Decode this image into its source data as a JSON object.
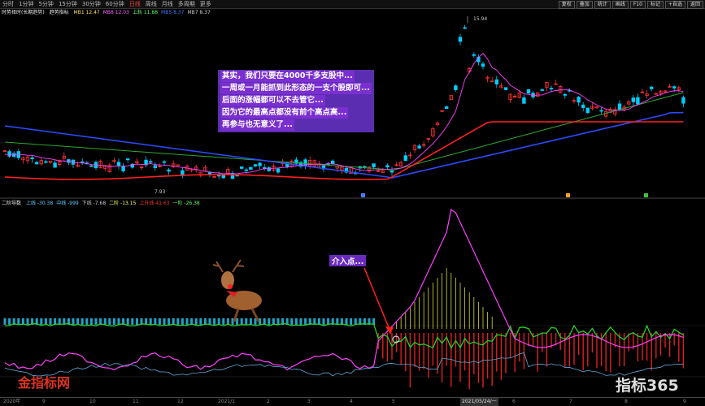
{
  "toolbar": {
    "tabs": [
      "分时",
      "1分钟",
      "5分钟",
      "15分钟",
      "30分钟",
      "60分钟",
      "日线",
      "周线",
      "月线",
      "多周期",
      "更多"
    ],
    "active_index": 6,
    "right_buttons": [
      "复权",
      "叠加",
      "统计",
      "画线",
      "F10",
      "标记",
      "+自选",
      "返回"
    ]
  },
  "indicators": {
    "title": "时势择时(长期趋势)",
    "sub": "趋势指标",
    "items": [
      {
        "text": "MB1 12.47",
        "color": "#ffe066"
      },
      {
        "text": "MB8 12.03",
        "color": "#ff66ff"
      },
      {
        "text": "上轨 11.88",
        "color": "#66ff66"
      },
      {
        "text": "MB5 8.37",
        "color": "#4a7aff"
      },
      {
        "text": "MB7 8.37",
        "color": "#cccccc"
      }
    ]
  },
  "sub_indicators": {
    "title": "二阶导数",
    "items": [
      {
        "text": "上线 -30.38",
        "color": "#66ccff"
      },
      {
        "text": "中线 -999",
        "color": "#66ccff"
      },
      {
        "text": "下线 -7.68",
        "color": "#cccccc"
      },
      {
        "text": "二阶 -13.15",
        "color": "#ffff66"
      },
      {
        "text": "上升线 41.63",
        "color": "#ff3333"
      },
      {
        "text": "一阶 -26.38",
        "color": "#66ff66"
      }
    ]
  },
  "annotations": {
    "note_lines": [
      "其实，我们只要在4000千多支股中...",
      "一周或一月能抓到此形态的一支个股即可...",
      "后面的涨幅都可以不去管它...",
      "因为它的最高点都没有前个高点高...",
      "再参与也无意义了..."
    ],
    "entry_label": "介入点...",
    "high_label": "15.94",
    "low_label": "7.93"
  },
  "axis": {
    "labels": [
      "2020年",
      "9",
      "10",
      "11",
      "12",
      "2021/1",
      "2",
      "3",
      "4",
      "5",
      "2021/05/24/一",
      "6",
      "7",
      "8",
      "9"
    ],
    "highlight": "2021/05/24/一"
  },
  "watermarks": {
    "left": "金指标网",
    "right": "指标365"
  },
  "colors": {
    "up": "#ff3333",
    "down": "#00ccff",
    "ma_red": "#ff2020",
    "ma_blue": "#2b4cff",
    "ma_green": "#2ea52e",
    "ma_magenta": "#ff40ff"
  }
}
